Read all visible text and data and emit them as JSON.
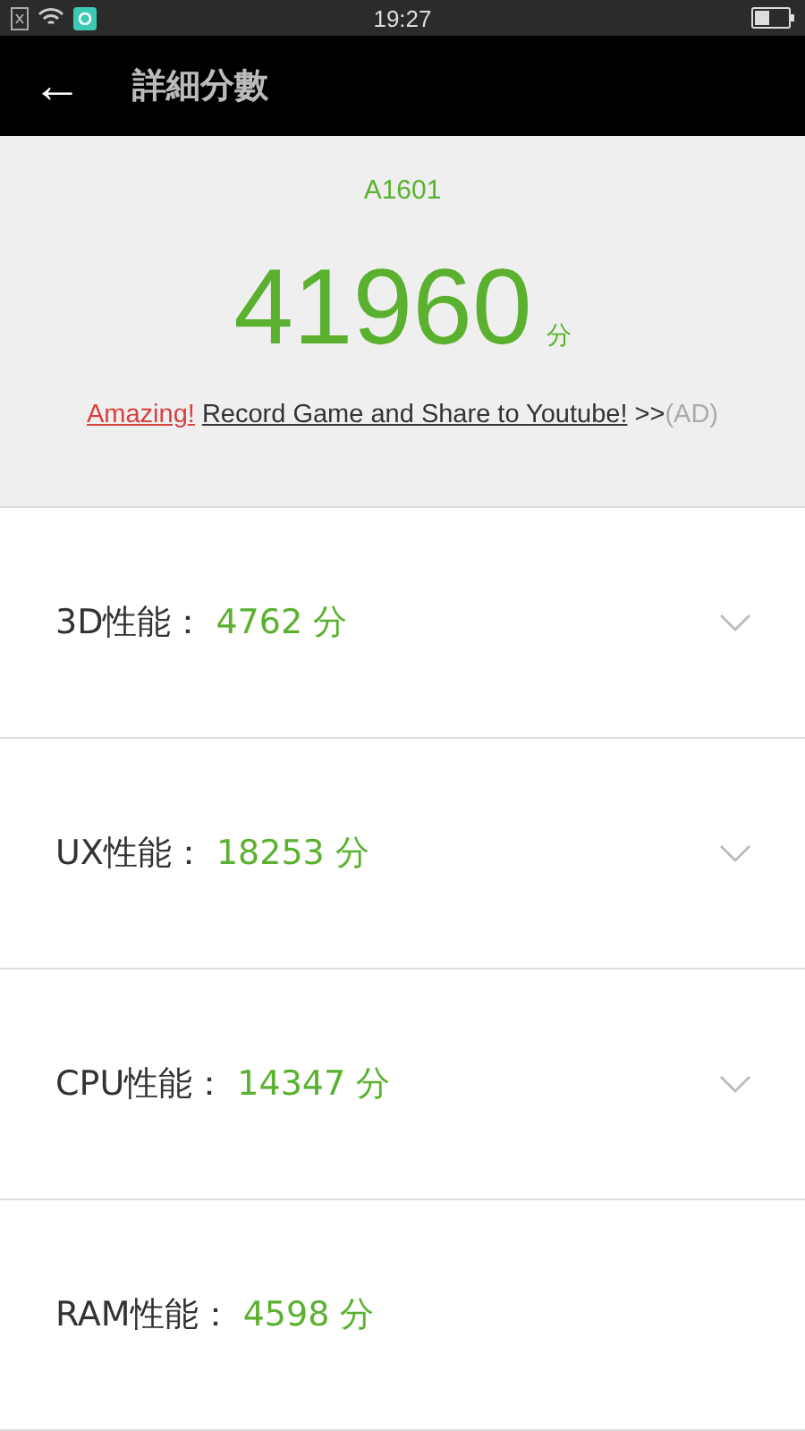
{
  "status_bar": {
    "time": "19:27"
  },
  "header": {
    "back": "←",
    "title": "詳細分數"
  },
  "summary": {
    "device": "A1601",
    "score": "41960",
    "unit": "分",
    "ad": {
      "highlight": "Amazing!",
      "link": "Record Game and Share to Youtube!",
      "arrows": ">>",
      "tag": "(AD)"
    }
  },
  "categories": [
    {
      "label": "3D性能：",
      "score": "4762 分",
      "expandable": true
    },
    {
      "label": "UX性能：",
      "score": "18253 分",
      "expandable": true
    },
    {
      "label": "CPU性能：",
      "score": "14347 分",
      "expandable": true
    },
    {
      "label": "RAM性能：",
      "score": "4598 分",
      "expandable": false
    }
  ]
}
